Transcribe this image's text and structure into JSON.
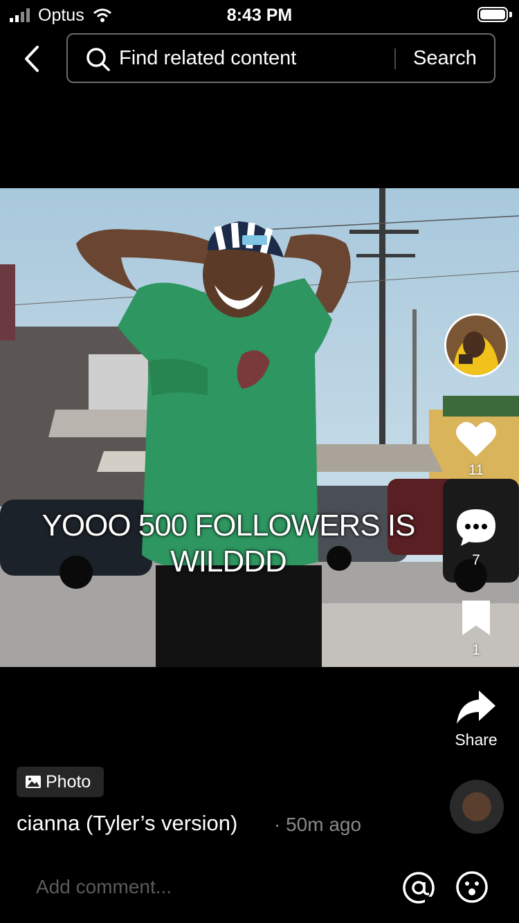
{
  "status_bar": {
    "carrier": "Optus",
    "time": "8:43 PM"
  },
  "header": {
    "search_placeholder": "Find related content",
    "search_button": "Search"
  },
  "post": {
    "caption": "YOOO 500 FOLLOWERS IS WILDDD",
    "badge": "Photo",
    "author": "cianna (Tyler’s version)",
    "time": "· 50m ago"
  },
  "actions": {
    "likes": "11",
    "comments": "7",
    "saves": "1",
    "share_label": "Share"
  },
  "comment_bar": {
    "placeholder": "Add comment..."
  },
  "icons": [
    "signal-icon",
    "wifi-icon",
    "battery-icon",
    "back-icon",
    "search-icon",
    "heart-icon",
    "comment-icon",
    "bookmark-icon",
    "share-icon",
    "photo-icon",
    "at-icon",
    "emoji-icon"
  ],
  "colors": {
    "background": "#000000",
    "muted_text": "#8a8a8a",
    "placeholder": "#5b5b5b",
    "search_border": "#6b6b6b"
  }
}
